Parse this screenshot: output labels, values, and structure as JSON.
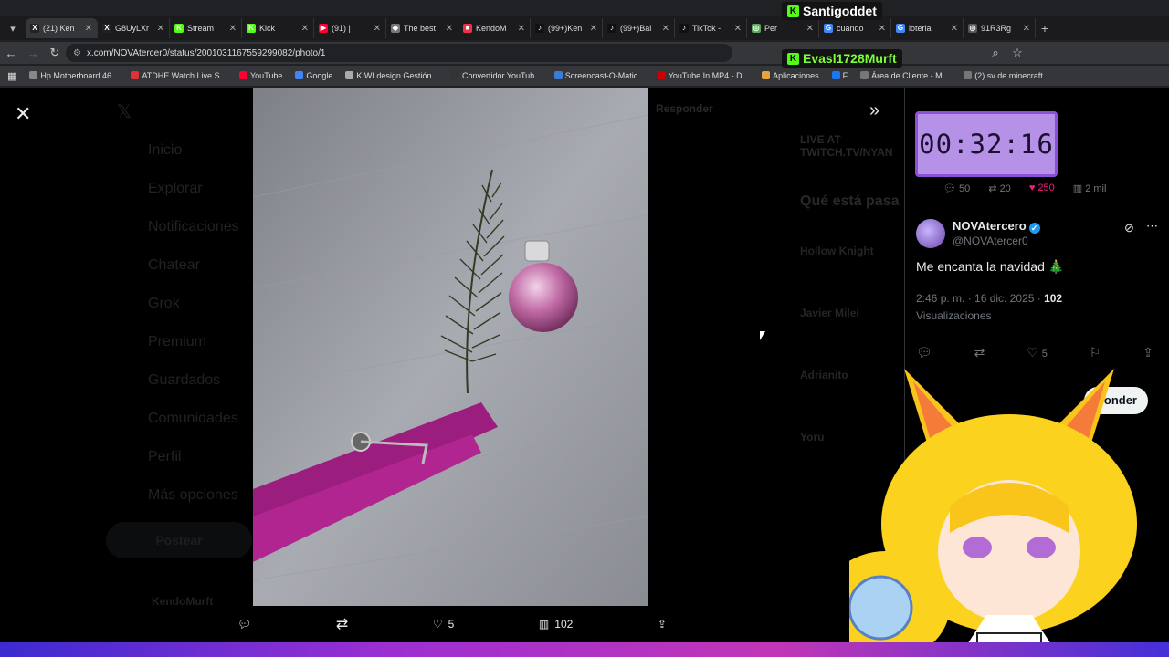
{
  "browser": {
    "tabs": [
      {
        "label": "(21) Ken",
        "color": "#222222",
        "glyph": "X"
      },
      {
        "label": "G8UyLXr",
        "color": "#222222",
        "glyph": "X"
      },
      {
        "label": "Stream",
        "color": "#53fc18",
        "glyph": "K"
      },
      {
        "label": "Kick",
        "color": "#53fc18",
        "glyph": "K"
      },
      {
        "label": "(91) |",
        "color": "#ff0033",
        "glyph": "▶"
      },
      {
        "label": "The best",
        "color": "#777777",
        "glyph": "◆"
      },
      {
        "label": "KendoM",
        "color": "#e8334a",
        "glyph": "■"
      },
      {
        "label": "(99+)Ken",
        "color": "#111111",
        "glyph": "♪"
      },
      {
        "label": "(99+)Bai",
        "color": "#111111",
        "glyph": "♪"
      },
      {
        "label": "TikTok -",
        "color": "#111111",
        "glyph": "♪"
      },
      {
        "label": "Per",
        "color": "#5a5",
        "glyph": "◎"
      },
      {
        "label": "cuando",
        "color": "#4285f4",
        "glyph": "G"
      },
      {
        "label": "loteria",
        "color": "#4285f4",
        "glyph": "G"
      },
      {
        "label": "91R3Rg",
        "color": "#555555",
        "glyph": "◎"
      }
    ],
    "url": "x.com/NOVAtercer0/status/2001031167559299082/photo/1",
    "bookmarks": [
      {
        "label": "Hp Motherboard 46...",
        "color": "#888888"
      },
      {
        "label": "ATDHE Watch Live S...",
        "color": "#d33"
      },
      {
        "label": "YouTube",
        "color": "#ff0033"
      },
      {
        "label": "Google",
        "color": "#4285f4"
      },
      {
        "label": "KIWI design Gestión...",
        "color": "#aaaaaa"
      },
      {
        "label": "Convertidor YouTub...",
        "color": "#333333"
      },
      {
        "label": "Screencast-O-Matic...",
        "color": "#3a7bd5"
      },
      {
        "label": "YouTube In MP4 - D...",
        "color": "#cc0000"
      },
      {
        "label": "Aplicaciones",
        "color": "#e8a33d"
      },
      {
        "label": "F",
        "color": "#1877f2"
      },
      {
        "label": "Área de Cliente - Mi...",
        "color": "#777777"
      },
      {
        "label": "(2) sv de minecraft...",
        "color": "#777777"
      }
    ]
  },
  "viewer": {
    "close_glyph": "✕",
    "expand_glyph": "»",
    "actions": {
      "reply": "",
      "repost": "",
      "likes": "5",
      "views": "102",
      "share": ""
    }
  },
  "dimmed_nav": [
    "Inicio",
    "Explorar",
    "Notificaciones",
    "Chatear",
    "Grok",
    "Premium",
    "Guardados",
    "Comunidades",
    "Perfil",
    "Más opciones"
  ],
  "dimmed_post_button": "Postear",
  "dimmed_user": "KendoMurft",
  "dimmed_trends": [
    "Hollow Knight",
    "Javier Milei",
    "Adrianito",
    "Yoru"
  ],
  "dimmed_header": {
    "reply": "Responder",
    "live": "LIVE AT TWITCH.TV/NYAN",
    "section": "Qué está pasa"
  },
  "tweet": {
    "prev_stats": {
      "replies": "50",
      "reposts": "20",
      "likes": "250",
      "views": "2 mil"
    },
    "author_name": "NOVAtercero",
    "author_handle": "@NOVAtercer0",
    "text": "Me encanta la navidad 🎄",
    "time": "2:46 p. m. · 16 dic. 2025 · ",
    "views_count": "102",
    "views_label": "Visualizaciones",
    "likes": "5",
    "reply_button": "ponder"
  },
  "stream_overlay": {
    "timer": "00:32:16",
    "user1": "Santigoddet",
    "user2": "Evasl1728Murft"
  },
  "colors": {
    "accent_like": "#f91880",
    "verified": "#1d9bf0",
    "kick_green": "#53fc18"
  }
}
